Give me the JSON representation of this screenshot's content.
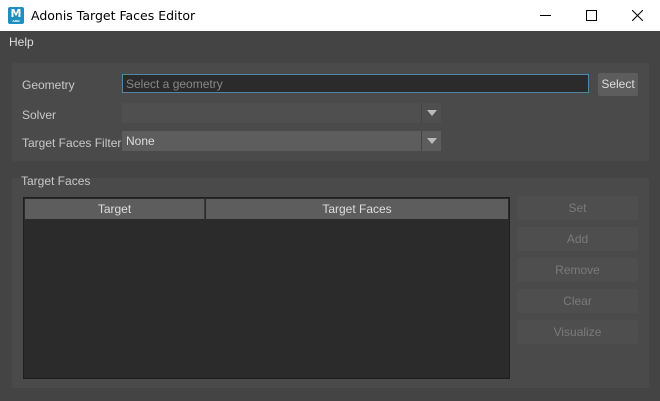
{
  "window": {
    "title": "Adonis Target Faces Editor",
    "icon_letter": "M",
    "icon_sub": "ADN"
  },
  "menu": {
    "help": "Help"
  },
  "form": {
    "geometry_label": "Geometry",
    "geometry_placeholder": "Select a geometry",
    "select_button": "Select",
    "solver_label": "Solver",
    "solver_value": "",
    "filter_label": "Target Faces Filter",
    "filter_value": "None"
  },
  "target_faces": {
    "group_title": "Target Faces",
    "columns": [
      "Target",
      "Target Faces"
    ],
    "rows": [],
    "buttons": {
      "set": "Set",
      "add": "Add",
      "remove": "Remove",
      "clear": "Clear",
      "visualize": "Visualize"
    }
  },
  "colors": {
    "background": "#444444",
    "panel": "#4a4a4a",
    "input_focus_border": "#5285a6"
  }
}
